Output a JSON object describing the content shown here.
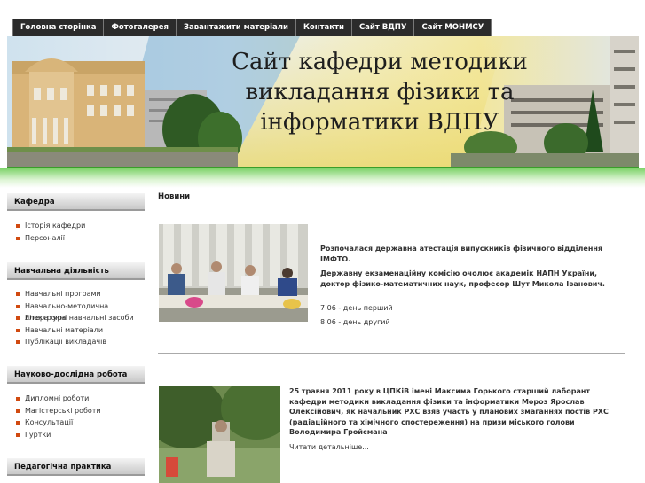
{
  "nav": {
    "items": [
      "Головна сторінка",
      "Фотогалерея",
      "Завантажити матеріали",
      "Контакти",
      "Сайт ВДПУ",
      "Сайт МОНМСУ"
    ]
  },
  "banner": {
    "title": "Сайт кафедри методики викладання фізики та інформатики ВДПУ"
  },
  "sidebar": {
    "sections": [
      {
        "title": "Кафедра",
        "items": [
          "Історія кафедри",
          "Персоналії"
        ]
      },
      {
        "title": "Навчальна діяльність",
        "items": [
          "Навчальні програми",
          "Навчально-методична література",
          "Електронні навчальні засоби",
          "Навчальні матеріали",
          "Публікації викладачів"
        ]
      },
      {
        "title": "Науково-дослідна робота",
        "items": [
          "Дипломні роботи",
          "Магістерські роботи",
          "Консультації",
          "Гуртки"
        ]
      },
      {
        "title": "Педагогічна практика",
        "items": []
      }
    ]
  },
  "main": {
    "news_heading": "Новини",
    "articles": [
      {
        "title": "Розпочалася державна атестація випускників фізичного відділення ІМФТО.",
        "subtitle": "Державну екзаменаційну комісію очолює академік НАПН України, доктор фізико-математичних наук, професор Шут Микола Іванович.",
        "line1": "7.06 - день перший",
        "line2": "8.06 - день другий"
      },
      {
        "title": "25 травня 2011 року в ЦПКіВ імені Максима Горького старший лаборант кафедри методики викладання фізики та інформатики Мороз Ярослав Олексійович, як начальник РХС взяв участь у планових змаганнях постів РХС (радіаційного та хімічного спостереження) на призи міського голови Володимира Гройсмана",
        "read_more": "Читати детальніше..."
      }
    ]
  }
}
